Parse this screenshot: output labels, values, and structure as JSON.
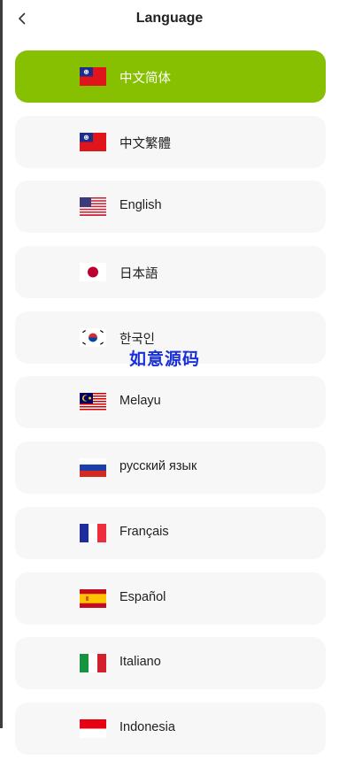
{
  "header": {
    "title": "Language"
  },
  "languages": [
    {
      "label": "中文简体",
      "flag": "taiwan-flag-icon",
      "selected": true
    },
    {
      "label": "中文繁體",
      "flag": "taiwan-flag-icon",
      "selected": false
    },
    {
      "label": "English",
      "flag": "us-flag-icon",
      "selected": false
    },
    {
      "label": "日本語",
      "flag": "japan-flag-icon",
      "selected": false
    },
    {
      "label": "한국인",
      "flag": "korea-flag-icon",
      "selected": false
    },
    {
      "label": "Melayu",
      "flag": "malaysia-flag-icon",
      "selected": false
    },
    {
      "label": "русский язык",
      "flag": "russia-flag-icon",
      "selected": false
    },
    {
      "label": "Français",
      "flag": "france-flag-icon",
      "selected": false
    },
    {
      "label": "Español",
      "flag": "spain-flag-icon",
      "selected": false
    },
    {
      "label": "Italiano",
      "flag": "italy-flag-icon",
      "selected": false
    },
    {
      "label": "Indonesia",
      "flag": "indonesia-flag-icon",
      "selected": false
    }
  ],
  "watermark": "如意源码",
  "colors": {
    "accent": "#86c000",
    "item_bg": "#f7f7f7",
    "watermark": "#1a2fd6"
  }
}
